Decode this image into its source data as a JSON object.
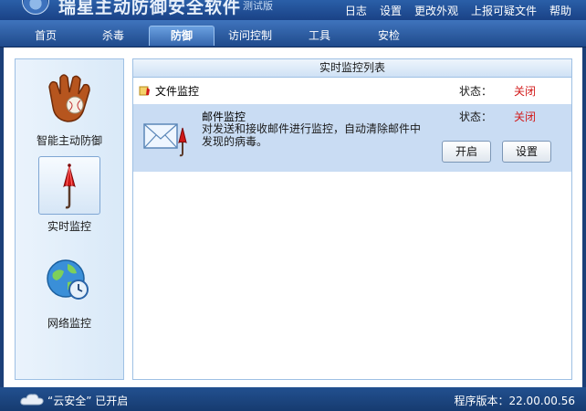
{
  "title": {
    "app_name": "瑞星主动防御安全软件",
    "edition": "测试版"
  },
  "top_menu": [
    "日志",
    "设置",
    "更改外观",
    "上报可疑文件",
    "帮助"
  ],
  "tabs": [
    "首页",
    "杀毒",
    "防御",
    "访问控制",
    "工具",
    "安检"
  ],
  "active_tab": "防御",
  "sidebar": {
    "items": [
      {
        "label": "智能主动防御",
        "icon": "baseball-glove-icon"
      },
      {
        "label": "实时监控",
        "icon": "umbrella-icon"
      },
      {
        "label": "网络监控",
        "icon": "globe-clock-icon"
      }
    ],
    "active": "实时监控"
  },
  "panel": {
    "header": "实时监控列表",
    "rows": [
      {
        "name": "文件监控",
        "status_label": "状态：",
        "status": "关闭",
        "icon": "file-shield-icon"
      },
      {
        "name": "邮件监控",
        "description": "对发送和接收邮件进行监控，自动清除邮件中发现的病毒。",
        "status_label": "状态：",
        "status": "关闭",
        "icon": "mail-umbrella-icon",
        "buttons": {
          "enable": "开启",
          "settings": "设置"
        }
      }
    ]
  },
  "statusbar": {
    "cloud": "“云安全” 已开启",
    "version": "程序版本：22.00.00.56"
  },
  "colors": {
    "status_off": "#d21a1a",
    "accent": "#1f4a8b",
    "selected_row": "#c9dcf3"
  }
}
